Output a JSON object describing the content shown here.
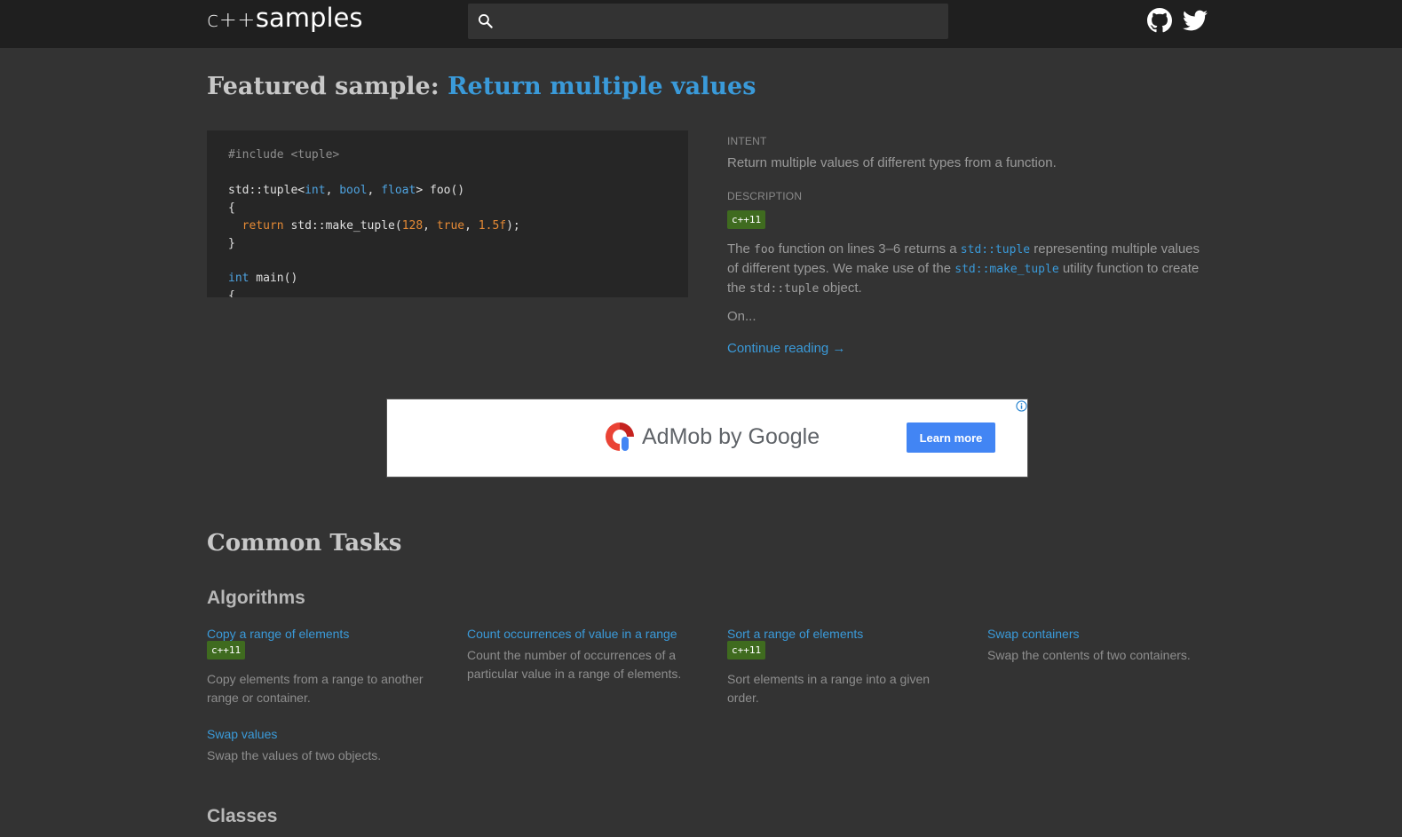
{
  "header": {
    "logo_prefix": "c++",
    "logo_name": "samples",
    "search_placeholder": ""
  },
  "featured": {
    "label": "Featured sample:",
    "link": "Return multiple values",
    "intent_label": "Intent",
    "intent": "Return multiple values of different types from a function.",
    "description_label": "Description",
    "badge": "c++11",
    "desc_parts": {
      "p1": "The ",
      "c1": "foo",
      "p2": " function on lines 3–6 returns a ",
      "c2": "std::tuple",
      "p3": " representing multiple values of different types. We make use of the ",
      "c3": "std::make_tuple",
      "p4": " utility function to create the ",
      "c4": "std::tuple",
      "p5": " object."
    },
    "more": "On...",
    "continue": "Continue reading →"
  },
  "code": {
    "l1": "#include <tuple>",
    "l3a": "std::tuple<",
    "l3k1": "int",
    "l3s1": ", ",
    "l3k2": "bool",
    "l3s2": ", ",
    "l3k3": "float",
    "l3b": "> foo()",
    "l4": "{",
    "l5ret": "return",
    "l5a": " std::make_tuple(",
    "l5n1": "128",
    "l5s1": ", ",
    "l5n2": "true",
    "l5s2": ", ",
    "l5n3": "1.5f",
    "l5b": ");",
    "l6": "}",
    "l8k": "int",
    "l8b": " main()",
    "l9": "{"
  },
  "ad": {
    "brand": "AdMob by Google",
    "button": "Learn more"
  },
  "tasks": {
    "title": "Common Tasks",
    "algorithms": "Algorithms",
    "classes": "Classes",
    "items": [
      {
        "title": "Copy a range of elements",
        "badge": "c++11",
        "desc": "Copy elements from a range to another range or container."
      },
      {
        "title": "Count occurrences of value in a range",
        "desc": "Count the number of occurrences of a particular value in a range of elements."
      },
      {
        "title": "Sort a range of elements",
        "badge": "c++11",
        "desc": "Sort elements in a range into a given order."
      },
      {
        "title": "Swap containers",
        "desc": "Swap the contents of two containers."
      },
      {
        "title": "Swap values",
        "desc": "Swap the values of two objects."
      }
    ]
  },
  "colors": {
    "background": "#333333",
    "header": "#1f1f1f",
    "link": "#3a9ad9",
    "badge": "#3f6b1f",
    "ad_button": "#4285f4"
  }
}
